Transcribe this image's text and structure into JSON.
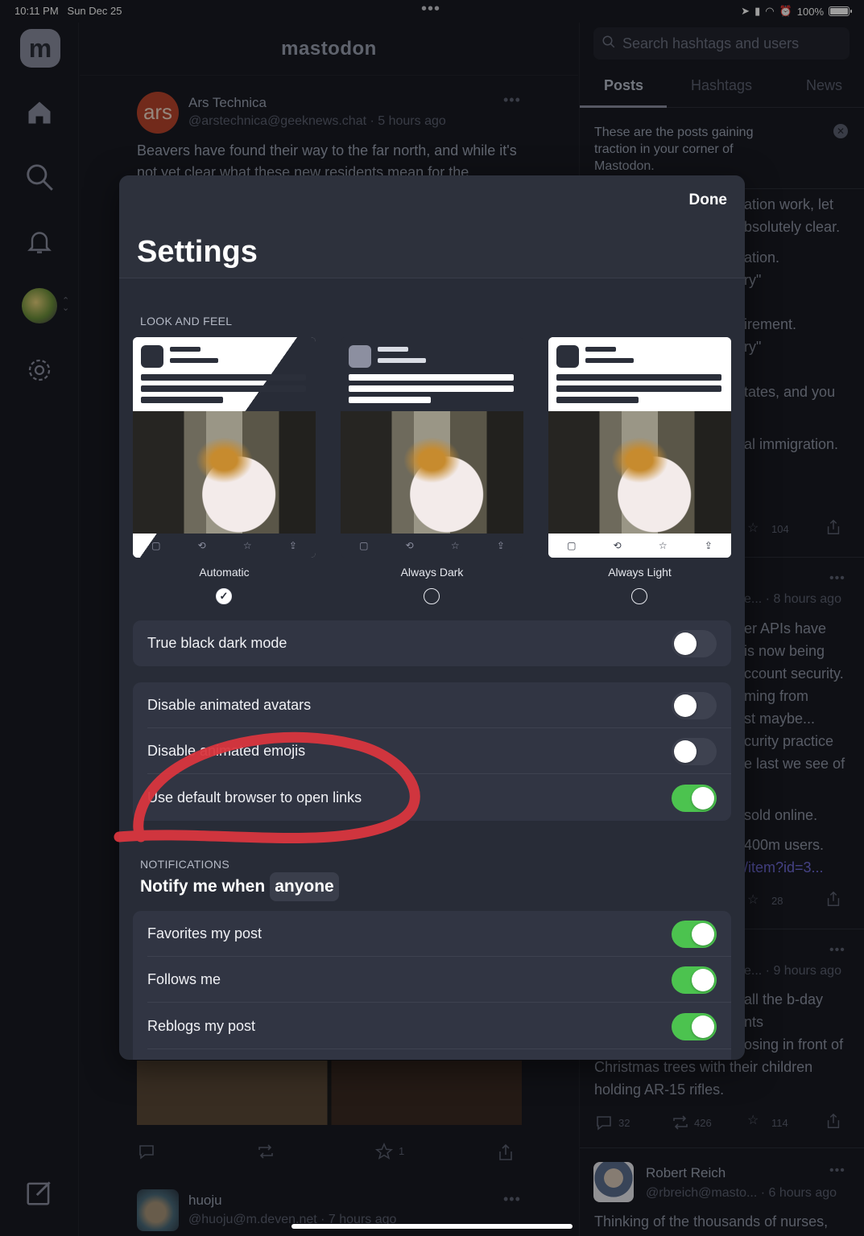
{
  "status_bar": {
    "time": "10:11 PM",
    "date": "Sun Dec 25",
    "dots": "•••",
    "battery": "100%"
  },
  "app": {
    "name": "mastodon",
    "logo_letter": "m"
  },
  "rail": {
    "items": [
      "home-icon",
      "search-icon",
      "bell-icon",
      "avatar",
      "gear-icon",
      "compose-icon"
    ]
  },
  "feed": {
    "posts": [
      {
        "avatar_text": "ars",
        "name": "Ars Technica",
        "handle": "@arstechnica@geeknews.chat · 5 hours ago",
        "text": "Beavers have found their way to the far north, and while it's not yet clear what these new residents mean for the"
      },
      {
        "name": "huoju",
        "handle": "@huoju@m.deven.net · 7 hours ago"
      }
    ],
    "actions": {
      "favorites": "1"
    }
  },
  "right": {
    "search_placeholder": "Search hashtags and users",
    "tabs": [
      "Posts",
      "Hashtags",
      "News"
    ],
    "note": "These are the posts gaining traction in your corner of Mastodon.",
    "fragments": [
      "ation work, let",
      "bsolutely clear.",
      "ation.",
      "ry\"",
      "irement.",
      "ry\"",
      "tates, and you",
      "al immigration."
    ],
    "post1_stats": {
      "favorites": "104"
    },
    "post2_meta": "e... · 8 hours ago",
    "post2_fragments": [
      "er APIs have",
      "is now being",
      "ccount security.",
      "ming from",
      "st maybe...",
      "curity practice",
      "e last we see of",
      "sold online.",
      "400m users.",
      "/item?id=3..."
    ],
    "post2_stats": {
      "favorites": "28"
    },
    "post3_meta": "e... · 9 hours ago",
    "post3_fragments": [
      "all the b-day",
      "nts",
      "osing in front of"
    ],
    "post3_text": [
      "Christmas trees with their children",
      "holding AR-15 rifles."
    ],
    "post3_stats": {
      "replies": "32",
      "boosts": "426",
      "favorites": "114"
    },
    "post4": {
      "name": "Robert Reich",
      "handle": "@rbreich@masto... · 6 hours ago",
      "text": "Thinking of the thousands of nurses,"
    }
  },
  "settings": {
    "done": "Done",
    "title": "Settings",
    "look_and_feel": "LOOK AND FEEL",
    "themes": [
      {
        "label": "Automatic",
        "selected": true
      },
      {
        "label": "Always Dark",
        "selected": false
      },
      {
        "label": "Always Light",
        "selected": false
      }
    ],
    "true_black": {
      "label": "True black dark mode",
      "on": false
    },
    "toggles": [
      {
        "label": "Disable animated avatars",
        "on": false
      },
      {
        "label": "Disable animated emojis",
        "on": false
      },
      {
        "label": "Use default browser to open links",
        "on": true
      }
    ],
    "notifications_label": "NOTIFICATIONS",
    "notify_prefix": "Notify me when",
    "notify_value": "anyone",
    "notify_toggles": [
      {
        "label": "Favorites my post",
        "on": true
      },
      {
        "label": "Follows me",
        "on": true
      },
      {
        "label": "Reblogs my post",
        "on": true
      }
    ],
    "accent": "#4cc34f",
    "annotation_color": "#d9363e"
  }
}
